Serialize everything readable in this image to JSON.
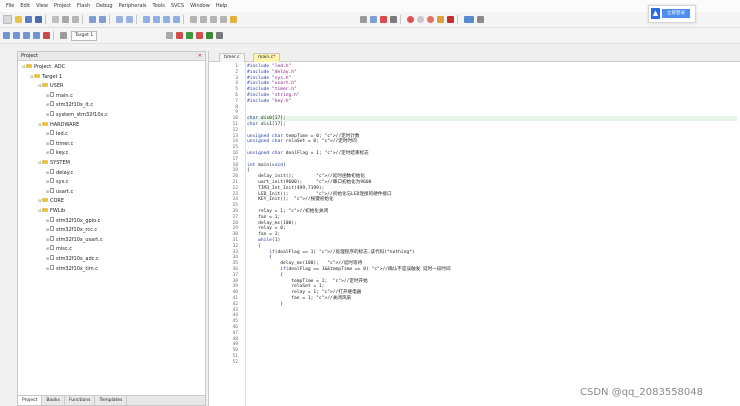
{
  "menubar": [
    "File",
    "Edit",
    "View",
    "Project",
    "Flash",
    "Debug",
    "Peripherals",
    "Tools",
    "SVCS",
    "Window",
    "Help"
  ],
  "toolbar": {
    "target": "Target 1"
  },
  "login": {
    "label": "立即登录"
  },
  "project": {
    "title": "Project",
    "tree": [
      {
        "label": "Project: ADC",
        "type": "root",
        "level": 0
      },
      {
        "label": "Target 1",
        "type": "folder",
        "level": 1
      },
      {
        "label": "USER",
        "type": "folder",
        "level": 2
      },
      {
        "label": "main.c",
        "type": "file",
        "level": 3
      },
      {
        "label": "stm32f10x_it.c",
        "type": "file",
        "level": 3
      },
      {
        "label": "system_stm32f10x.c",
        "type": "file",
        "level": 3
      },
      {
        "label": "HARDWARE",
        "type": "folder",
        "level": 2
      },
      {
        "label": "led.c",
        "type": "file",
        "level": 3
      },
      {
        "label": "timer.c",
        "type": "file",
        "level": 3
      },
      {
        "label": "key.c",
        "type": "file",
        "level": 3
      },
      {
        "label": "SYSTEM",
        "type": "folder",
        "level": 2
      },
      {
        "label": "delay.c",
        "type": "file",
        "level": 3
      },
      {
        "label": "sys.c",
        "type": "file",
        "level": 3
      },
      {
        "label": "usart.c",
        "type": "file",
        "level": 3
      },
      {
        "label": "CORE",
        "type": "folder",
        "level": 2
      },
      {
        "label": "FWLib",
        "type": "folder",
        "level": 2
      },
      {
        "label": "stm32f10x_gpio.c",
        "type": "file",
        "level": 3
      },
      {
        "label": "stm32f10x_rcc.c",
        "type": "file",
        "level": 3
      },
      {
        "label": "stm32f10x_usart.c",
        "type": "file",
        "level": 3
      },
      {
        "label": "misc.c",
        "type": "file",
        "level": 3
      },
      {
        "label": "stm32f10x_adc.c",
        "type": "file",
        "level": 3
      },
      {
        "label": "stm32f10x_tim.c",
        "type": "file",
        "level": 3
      }
    ],
    "tabs": [
      "Project",
      "Books",
      "Functions",
      "Templates"
    ]
  },
  "editor": {
    "tabs": [
      "timer.c",
      "main.c*"
    ],
    "line_numbers": [
      "1",
      "2",
      "3",
      "4",
      "5",
      "6",
      "7",
      "8",
      "9",
      "10",
      "11",
      "12",
      "13",
      "14",
      "15",
      "16",
      "17",
      "18",
      "19",
      "20",
      "21",
      "22",
      "23",
      "24",
      "25",
      "26",
      "27",
      "28",
      "29",
      "30",
      "31",
      "32",
      "33",
      "34",
      "35",
      "36",
      "37",
      "38",
      "39",
      "40",
      "41",
      "42",
      "43",
      "44",
      "45",
      "46",
      "47",
      "48",
      "49",
      "50",
      "51",
      "52"
    ],
    "code": [
      "#include \"led.h\"",
      "#include \"delay.h\"",
      "#include \"sys.h\"",
      "#include \"usart.h\"",
      "#include \"timer.h\"",
      "#include \"string.h\"",
      "#include \"key.h\"",
      "",
      "",
      "char dis0[17];",
      "char dis1[17];",
      "",
      "unsigned char tempTime = 0; //定时计数",
      "unsigned char relaSet = 0; //定时时间",
      "",
      "unsigned char dealFlag = 1; //定时结束标志",
      "",
      "int main(void)",
      "{",
      "    delay_init();        //延时函数初始化",
      "    uart_init(9600);     //串口初始化为9600",
      "    TIM3_Int_Init(499,7199);",
      "    LED_Init();          //初始化与LED连接的硬件接口",
      "    KEY_Init();  //按键初始化",
      "",
      "    relay = 1; //初始化关闭",
      "    fan = 1;",
      "    delay_ms(100);",
      "    relay = 0;",
      "    fan = 1;",
      "    while(1)",
      "    {",
      "        if(dealFlag == 1) //处理程序的标志,该代码(*nothing*)",
      "        {",
      "            delay_ms(100);   //延时等待",
      "            if(dealFlag == 1&&tempTime == 0) //确认不是误触发 延时一段时间",
      "            {",
      "                tempTime = 1;  //定时开始",
      "                relaSet = 1;",
      "                relay = 1; //打开继电器",
      "                fan = 1; //关闭风扇",
      "            }",
      "",
      "",
      "",
      "",
      "",
      "",
      "",
      "",
      "",
      ""
    ]
  },
  "watermark": "CSDN @qq_2083558048",
  "colors": {
    "accent": "#2a6ee6",
    "keyword": "#1f3ba8",
    "string": "#8a1a8a",
    "comment": "#2b8a2b",
    "highlight": "#e6f5e6"
  }
}
